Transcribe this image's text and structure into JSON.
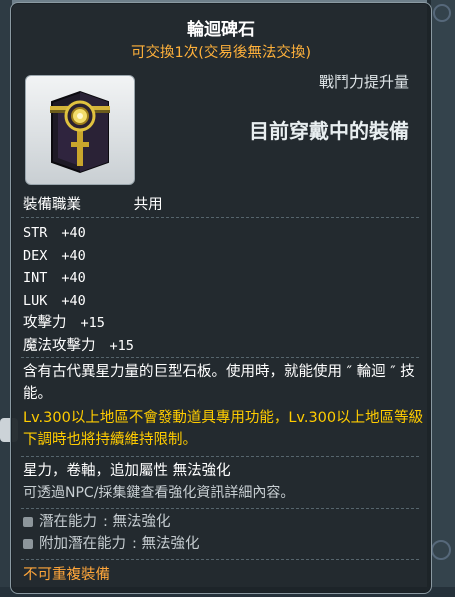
{
  "tooltip": {
    "item_name": "輪迴碑石",
    "trade_info": "可交換1次(交易後無法交換)",
    "power_label": "戰鬥力提升量",
    "equipped_label": "目前穿戴中的裝備",
    "job_label": "裝備職業",
    "job_value": "共用",
    "stats": [
      {
        "name": "STR",
        "value": "+40"
      },
      {
        "name": "DEX",
        "value": "+40"
      },
      {
        "name": "INT",
        "value": "+40"
      },
      {
        "name": "LUK",
        "value": "+40"
      },
      {
        "name": "攻擊力",
        "value": "+15"
      },
      {
        "name": "魔法攻擊力",
        "value": "+15"
      }
    ],
    "description": "含有古代異星力量的巨型石板。使用時，就能使用 ″ 輪迴 ″ 技能。",
    "note": "Lv.300以上地區不會發動道具專用功能，Lv.300以上地區等級下調時也將持續維持限制。",
    "enhance_line": "星力，卷軸，追加屬性 無法強化",
    "enhance_hint": "可透過NPC/採集鍵查看強化資訊詳細內容。",
    "potential": {
      "label": "潛在能力",
      "value": ": 無法強化"
    },
    "additional_potential": {
      "label": "附加潛在能力",
      "value": ": 無法強化"
    },
    "unique_label": "不可重複裝備"
  },
  "colors": {
    "trade_info": "#ffb13b",
    "note": "#ffcc00",
    "unique": "#ffa63a",
    "tooltip_bg": "#1d2428"
  },
  "icons": {
    "item": "rebirth-stone-icon"
  }
}
